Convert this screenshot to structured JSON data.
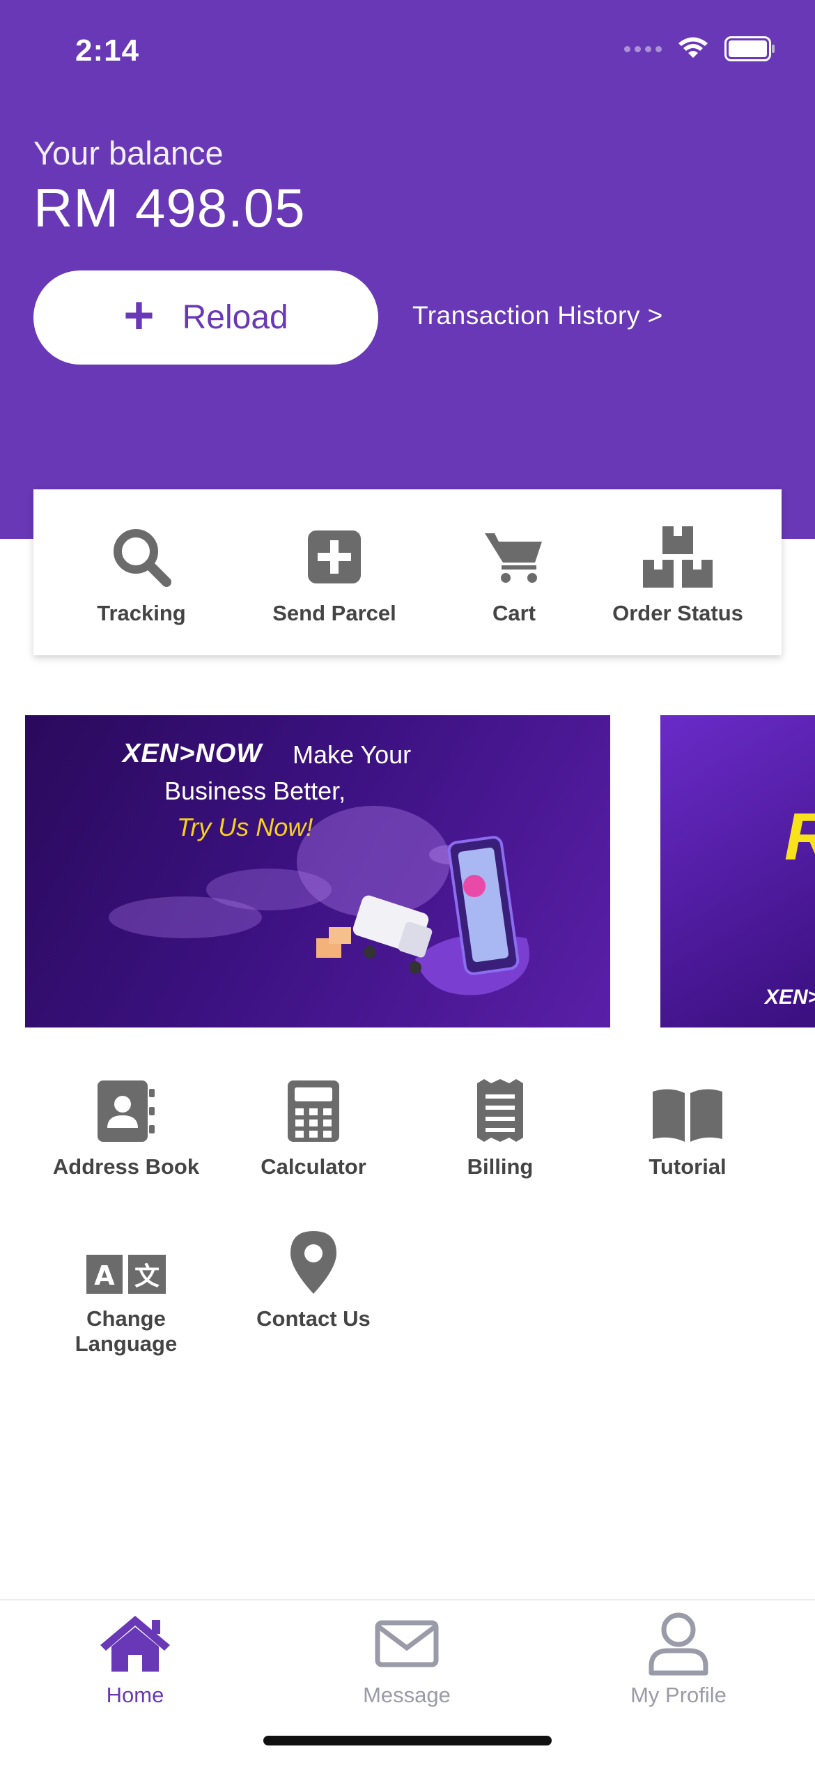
{
  "status_bar": {
    "time": "2:14"
  },
  "wallet": {
    "balance_label": "Your balance",
    "balance_value": "RM 498.05",
    "reload_label": "Reload",
    "transaction_history_label": "Transaction History >"
  },
  "quick_actions": [
    {
      "label": "Tracking",
      "icon": "search-icon"
    },
    {
      "label": "Send Parcel",
      "icon": "plus-square-icon"
    },
    {
      "label": "Cart",
      "icon": "cart-icon"
    },
    {
      "label": "Order Status",
      "icon": "boxes-icon"
    }
  ],
  "banners": [
    {
      "brand": "XEN>NOW",
      "line1": "Make Your",
      "line2": "Business Better,",
      "line3": "Try Us Now!"
    },
    {
      "big": "RM",
      "brand": "XEN>"
    }
  ],
  "menu": [
    {
      "label": "Address Book",
      "icon": "address-book-icon"
    },
    {
      "label": "Calculator",
      "icon": "calculator-icon"
    },
    {
      "label": "Billing",
      "icon": "receipt-icon"
    },
    {
      "label": "Tutorial",
      "icon": "book-icon"
    },
    {
      "label": "Change\nLanguage",
      "icon": "language-icon"
    },
    {
      "label": "Contact Us",
      "icon": "map-pin-icon"
    }
  ],
  "tabs": [
    {
      "label": "Home",
      "icon": "home-icon",
      "active": true
    },
    {
      "label": "Message",
      "icon": "envelope-icon",
      "active": false
    },
    {
      "label": "My Profile",
      "icon": "user-icon",
      "active": false
    }
  ],
  "colors": {
    "brand": "#6838b6",
    "icon_gray": "#6b6b6b",
    "tab_inactive": "#9a9aa8",
    "banner_yellow": "#f7d21c"
  }
}
